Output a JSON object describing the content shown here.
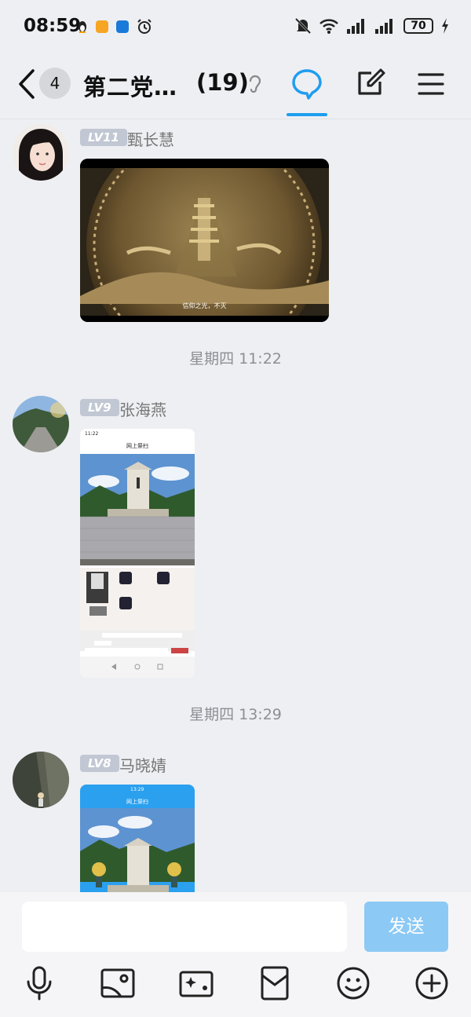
{
  "status": {
    "time": "08:59",
    "battery": "70"
  },
  "header": {
    "unread_count": "4",
    "title": "第二党…",
    "member_count": "(19)"
  },
  "messages": [
    {
      "level": "LV11",
      "sender": "甄长慧",
      "caption": "信仰之光，不灭"
    },
    {
      "time_divider": "星期四 11:22"
    },
    {
      "level": "LV9",
      "sender": "张海燕",
      "shot_time": "11:22",
      "shot_title": "网上祭扫"
    },
    {
      "time_divider": "星期四 13:29"
    },
    {
      "level": "LV8",
      "sender": "马晓婧",
      "shot_time": "13:29",
      "shot_title": "网上祭扫"
    }
  ],
  "input": {
    "placeholder": "",
    "send_label": "发送"
  },
  "colors": {
    "accent": "#1f9df0",
    "send_disabled": "#8cc9f5",
    "level_badge": "#c1c7d3"
  }
}
